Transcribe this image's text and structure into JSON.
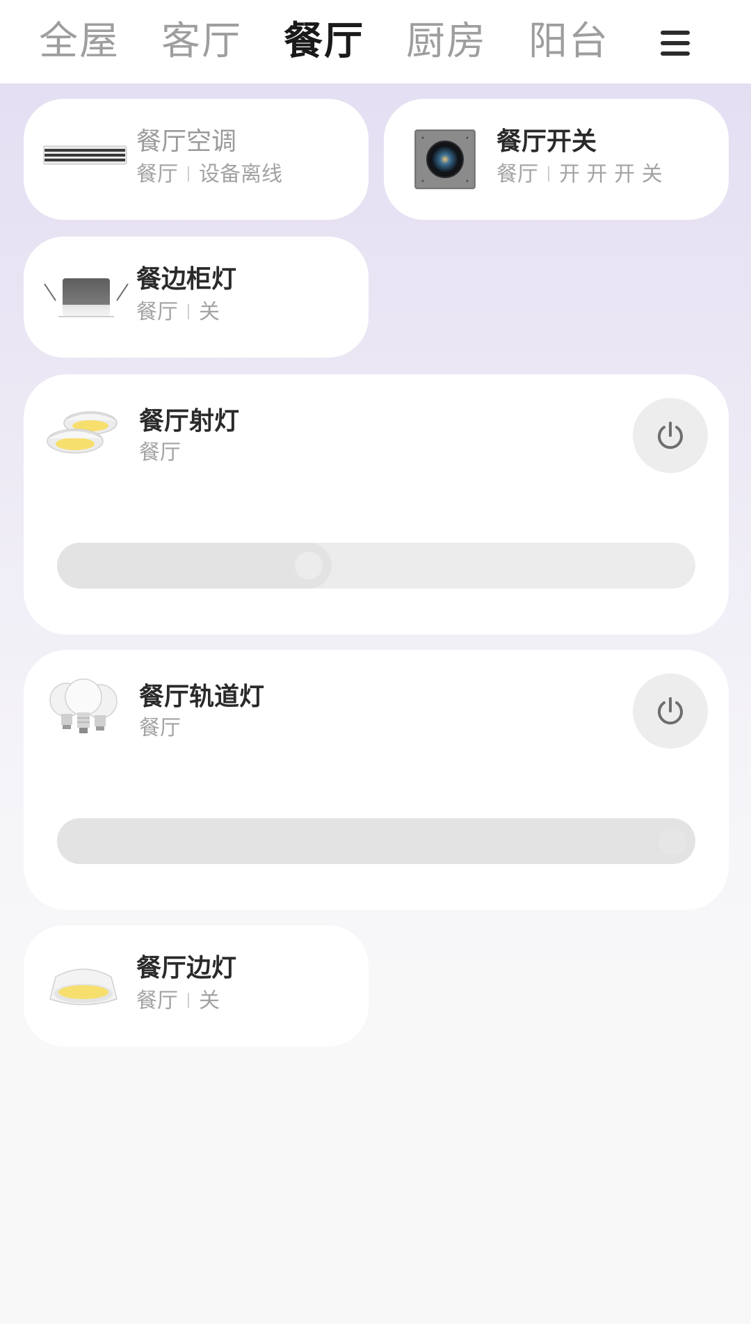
{
  "tabs": [
    {
      "label": "全屋",
      "active": false
    },
    {
      "label": "客厅",
      "active": false
    },
    {
      "label": "餐厅",
      "active": true
    },
    {
      "label": "厨房",
      "active": false
    },
    {
      "label": "阳台",
      "active": false
    }
  ],
  "menu_icon": "hamburger-menu-icon",
  "devices": {
    "ac": {
      "name": "餐厅空调",
      "room": "餐厅",
      "status": "设备离线",
      "icon": "air-conditioner-icon"
    },
    "switch": {
      "name": "餐厅开关",
      "room": "餐厅",
      "status": "开 开 开 关",
      "icon": "wall-switch-panel-icon"
    },
    "cabinet_light": {
      "name": "餐边柜灯",
      "room": "餐厅",
      "status": "关",
      "icon": "downlight-icon"
    },
    "spotlight": {
      "name": "餐厅射灯",
      "room": "餐厅",
      "brightness_fraction": 0.43,
      "icon": "spotlight-icon",
      "power_icon": "power-icon"
    },
    "track_light": {
      "name": "餐厅轨道灯",
      "room": "餐厅",
      "brightness_fraction": 1.0,
      "icon": "bulbs-icon",
      "power_icon": "power-icon"
    },
    "side_light": {
      "name": "餐厅边灯",
      "room": "餐厅",
      "status": "关",
      "icon": "recessed-light-icon"
    }
  },
  "colors": {
    "active_tab": "#1a1a1a",
    "inactive_tab": "#9e9e9e",
    "card": "#ffffff",
    "warm_light": "#f7df6e"
  }
}
